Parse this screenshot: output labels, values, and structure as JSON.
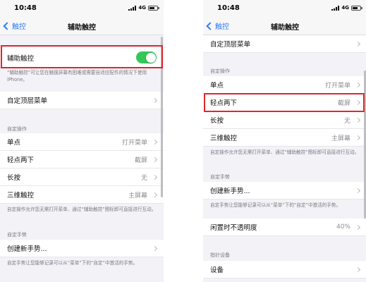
{
  "left": {
    "status": {
      "time": "10:48",
      "network": "4G"
    },
    "nav": {
      "back_label": "触控",
      "title": "辅助触控"
    },
    "assistive_touch": {
      "label": "辅助触控",
      "enabled": true
    },
    "assistive_footer": "“辅助触控”可让您在触摸屏幕有困难或需要自适应配件的情况下使用iPhone。",
    "customize_menu": {
      "label": "自定顶层菜单"
    },
    "custom_actions_header": "自定操作",
    "actions": [
      {
        "label": "单点",
        "value": "打开菜单"
      },
      {
        "label": "轻点两下",
        "value": "截屏"
      },
      {
        "label": "长按",
        "value": "无"
      },
      {
        "label": "三维触控",
        "value": "主屏幕"
      }
    ],
    "actions_footer": "自定操作允许您无需打开菜单、通过“辅助触控”图标即可直接进行互动。",
    "custom_gestures_header": "自定手势",
    "create_gesture": {
      "label": "创建新手势..."
    },
    "gestures_footer": "自定手势让您能够记录可以从“菜单”下的“自定”中激活的手势。"
  },
  "right": {
    "status": {
      "time": "10:48",
      "network": "4G"
    },
    "nav": {
      "back_label": "触控",
      "title": "辅助触控"
    },
    "customize_menu": {
      "label": "自定顶层菜单"
    },
    "custom_actions_header": "自定操作",
    "actions": [
      {
        "label": "单点",
        "value": "打开菜单"
      },
      {
        "label": "轻点两下",
        "value": "截屏"
      },
      {
        "label": "长按",
        "value": "无"
      },
      {
        "label": "三维触控",
        "value": "主屏幕"
      }
    ],
    "actions_footer": "自定操作允许您无需打开菜单、通过“辅助触控”图标即可直接进行互动。",
    "custom_gestures_header": "自定手势",
    "create_gesture": {
      "label": "创建新手势..."
    },
    "gestures_footer": "自定手势让您能够记录可以从“菜单”下的“自定”中激活的手势。",
    "idle_opacity": {
      "label": "闲置时不透明度",
      "value": "40%"
    },
    "pointer_header": "指针设备",
    "devices": {
      "label": "设备"
    }
  },
  "colors": {
    "accent": "#2f7cf6",
    "toggle_on": "#34c759",
    "highlight": "#e2262a"
  }
}
